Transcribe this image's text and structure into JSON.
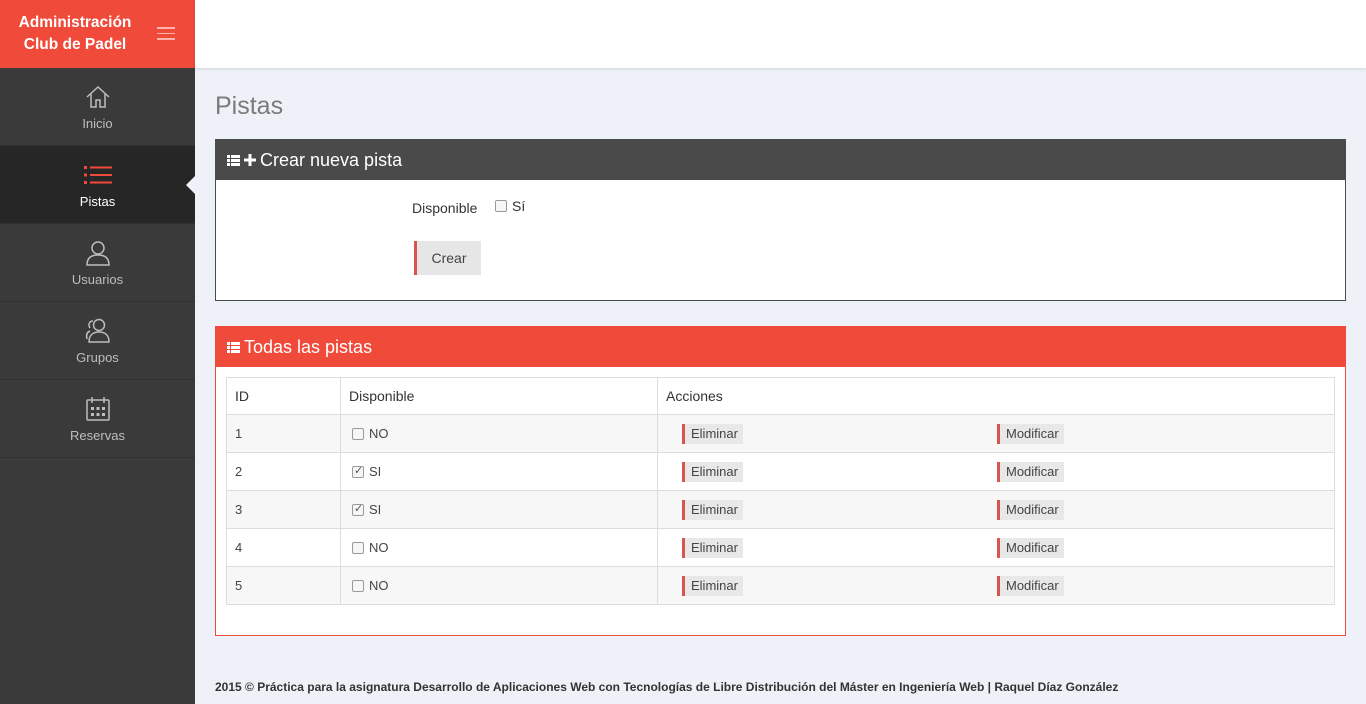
{
  "brand": {
    "line1": "Administración",
    "line2": "Club de Padel"
  },
  "sidebar": {
    "items": [
      {
        "label": "Inicio",
        "icon": "home-icon",
        "active": false
      },
      {
        "label": "Pistas",
        "icon": "list-icon",
        "active": true
      },
      {
        "label": "Usuarios",
        "icon": "user-icon",
        "active": false
      },
      {
        "label": "Grupos",
        "icon": "users-icon",
        "active": false
      },
      {
        "label": "Reservas",
        "icon": "calendar-icon",
        "active": false
      }
    ]
  },
  "page": {
    "title": "Pistas"
  },
  "create_panel": {
    "title": "Crear nueva pista",
    "field_label": "Disponible",
    "checkbox_label": "Sí",
    "submit_label": "Crear"
  },
  "list_panel": {
    "title": "Todas las pistas",
    "columns": [
      "ID",
      "Disponible",
      "Acciones"
    ],
    "rows": [
      {
        "id": "1",
        "disponible": "NO",
        "checked": false
      },
      {
        "id": "2",
        "disponible": "SI",
        "checked": true
      },
      {
        "id": "3",
        "disponible": "SI",
        "checked": true
      },
      {
        "id": "4",
        "disponible": "NO",
        "checked": false
      },
      {
        "id": "5",
        "disponible": "NO",
        "checked": false
      }
    ],
    "delete_label": "Eliminar",
    "edit_label": "Modificar"
  },
  "footer": {
    "text": "2015 © Práctica para la asignatura Desarrollo de Aplicaciones Web con Tecnologías de Libre Distribución del Máster en Ingeniería Web | Raquel Díaz González"
  },
  "colors": {
    "accent": "#f04a3a",
    "sidebar": "#3a3a3a",
    "panel_dark": "#4a4a4a"
  }
}
